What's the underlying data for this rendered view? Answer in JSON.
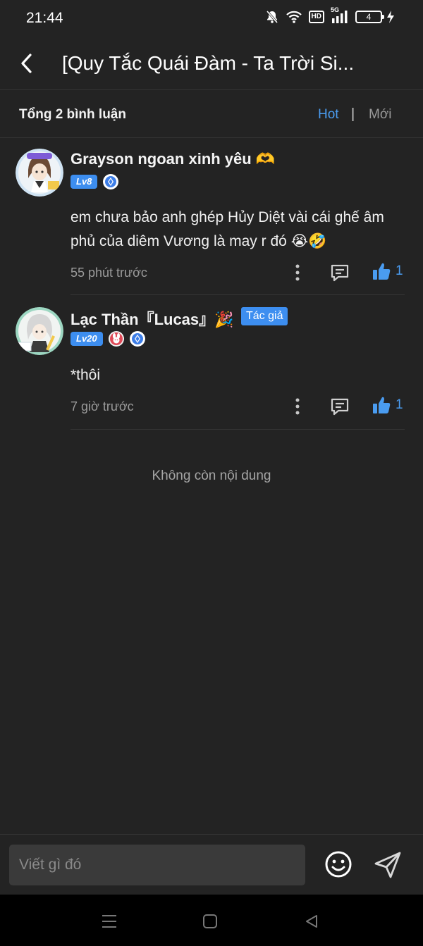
{
  "status_bar": {
    "time": "21:44",
    "network": "5G",
    "hd_label": "HD",
    "battery": "4",
    "icons": [
      "bell-muted-icon",
      "wifi-icon",
      "hd-icon",
      "signal-5g-icon",
      "battery-icon",
      "charging-bolt-icon"
    ]
  },
  "header": {
    "back_icon": "chevron-left-icon",
    "title": "[Quy Tắc Quái Đàm - Ta Trời Si..."
  },
  "sort_bar": {
    "total_label": "Tổng 2 bình luận",
    "hot_label": "Hot",
    "separator": "|",
    "new_label": "Mới",
    "active": "Hot",
    "active_color": "#4a9cf0"
  },
  "comments": [
    {
      "username": "Grayson ngoan xinh yêu 🫶",
      "level": "Lv8",
      "badges": [
        "blue-gem-badge"
      ],
      "is_author": false,
      "text": "em chưa bảo anh ghép Hủy Diệt vài cái ghế âm phủ của diêm Vương là may r đó 😭🤣",
      "time": "55 phút trước",
      "likes": "1"
    },
    {
      "username": "Lạc Thần『Lucas』🎉",
      "level": "Lv20",
      "badges": [
        "red-rabbit-badge",
        "blue-gem-badge"
      ],
      "is_author": true,
      "author_label": "Tác giả",
      "text": "*thôi",
      "time": "7 giờ trước",
      "likes": "1"
    }
  ],
  "end_message": "Không còn nội dung",
  "input_bar": {
    "placeholder": "Viết gì đó",
    "emoji_icon": "smiley-face-icon",
    "send_icon": "send-paper-plane-icon"
  },
  "nav_bar": {
    "icons": [
      "menu-lines-icon",
      "home-square-icon",
      "back-triangle-icon"
    ]
  },
  "colors": {
    "background": "#232323",
    "accent": "#4a9cf0",
    "secondary_text": "#9b9b9b"
  }
}
